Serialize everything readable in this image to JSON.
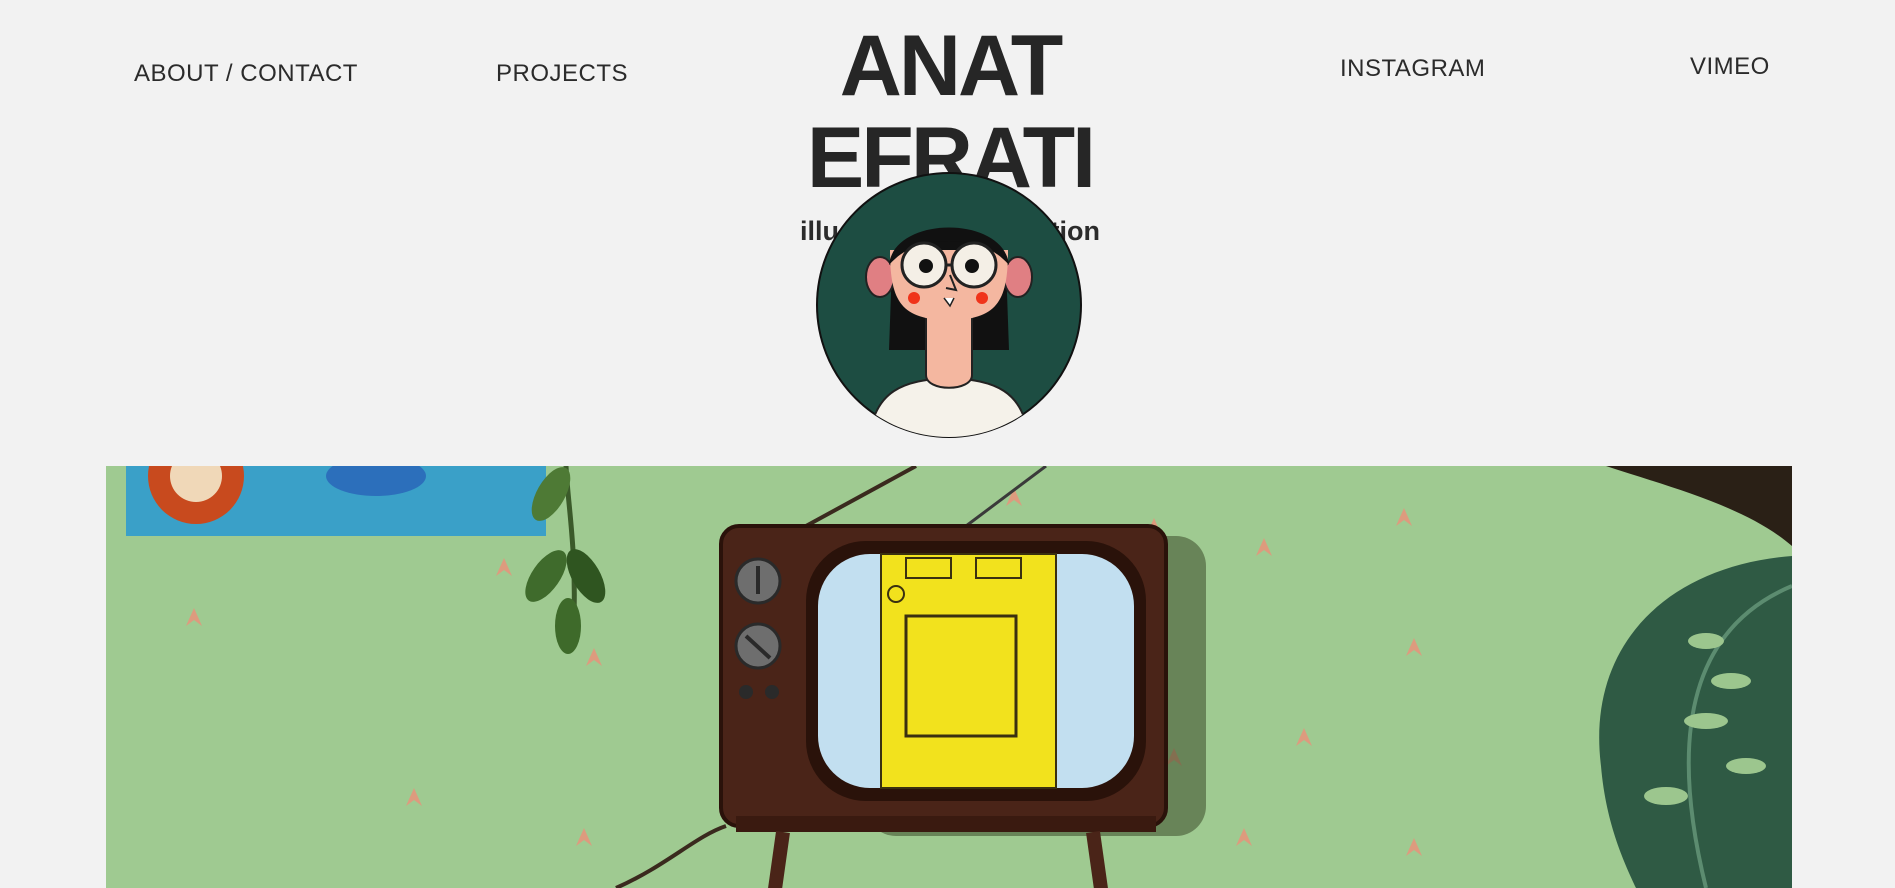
{
  "nav": {
    "about_contact": "ABOUT / CONTACT",
    "projects": "PROJECTS",
    "instagram": "INSTAGRAM",
    "vimeo": "VIMEO"
  },
  "brand": {
    "title": "ANAT EFRATI",
    "subtitle": "illustration & animation"
  },
  "colors": {
    "background": "#f2f2f2",
    "text": "#2a2a2a",
    "avatar_bg": "#1d4d42",
    "hero_wall": "#9cc68e",
    "tv_wood": "#4a2418",
    "tv_screen_door": "#f2e21d"
  },
  "avatar": {
    "icon": "illustrated-self-portrait-avatar"
  },
  "hero": {
    "icon": "animated-illustration-retro-tv"
  }
}
